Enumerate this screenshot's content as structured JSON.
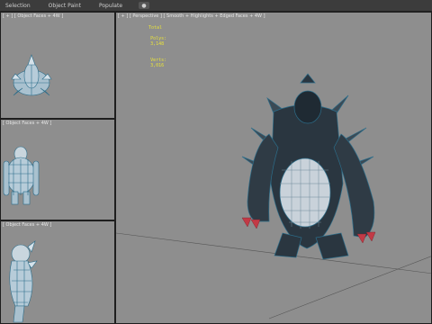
{
  "menu": {
    "tabs": [
      "Selection",
      "Object Paint",
      "Populate"
    ],
    "eye_icon": "eye-icon"
  },
  "viewports": {
    "top": {
      "label": "[ + ] [ Object Faces + 4W ]"
    },
    "front": {
      "label": "[ Object Faces + 4W ]"
    },
    "left": {
      "label": "[ Object Faces + 4W ]"
    },
    "perspective": {
      "label": "[ + ] [ Perspective ] [ Smooth + Highlights + Edged Faces + 4W ]",
      "stats": {
        "title": "Total",
        "polys_label": "Polys:",
        "polys_value": "3,148",
        "verts_label": "Verts:",
        "verts_value": "3,016"
      }
    }
  },
  "colors": {
    "viewport_bg": "#8e8e8e",
    "mesh_wire": "#2c6d8a",
    "mesh_dark": "#1f2a33",
    "claw": "#c23a46",
    "stats_text": "#e9e33a"
  }
}
